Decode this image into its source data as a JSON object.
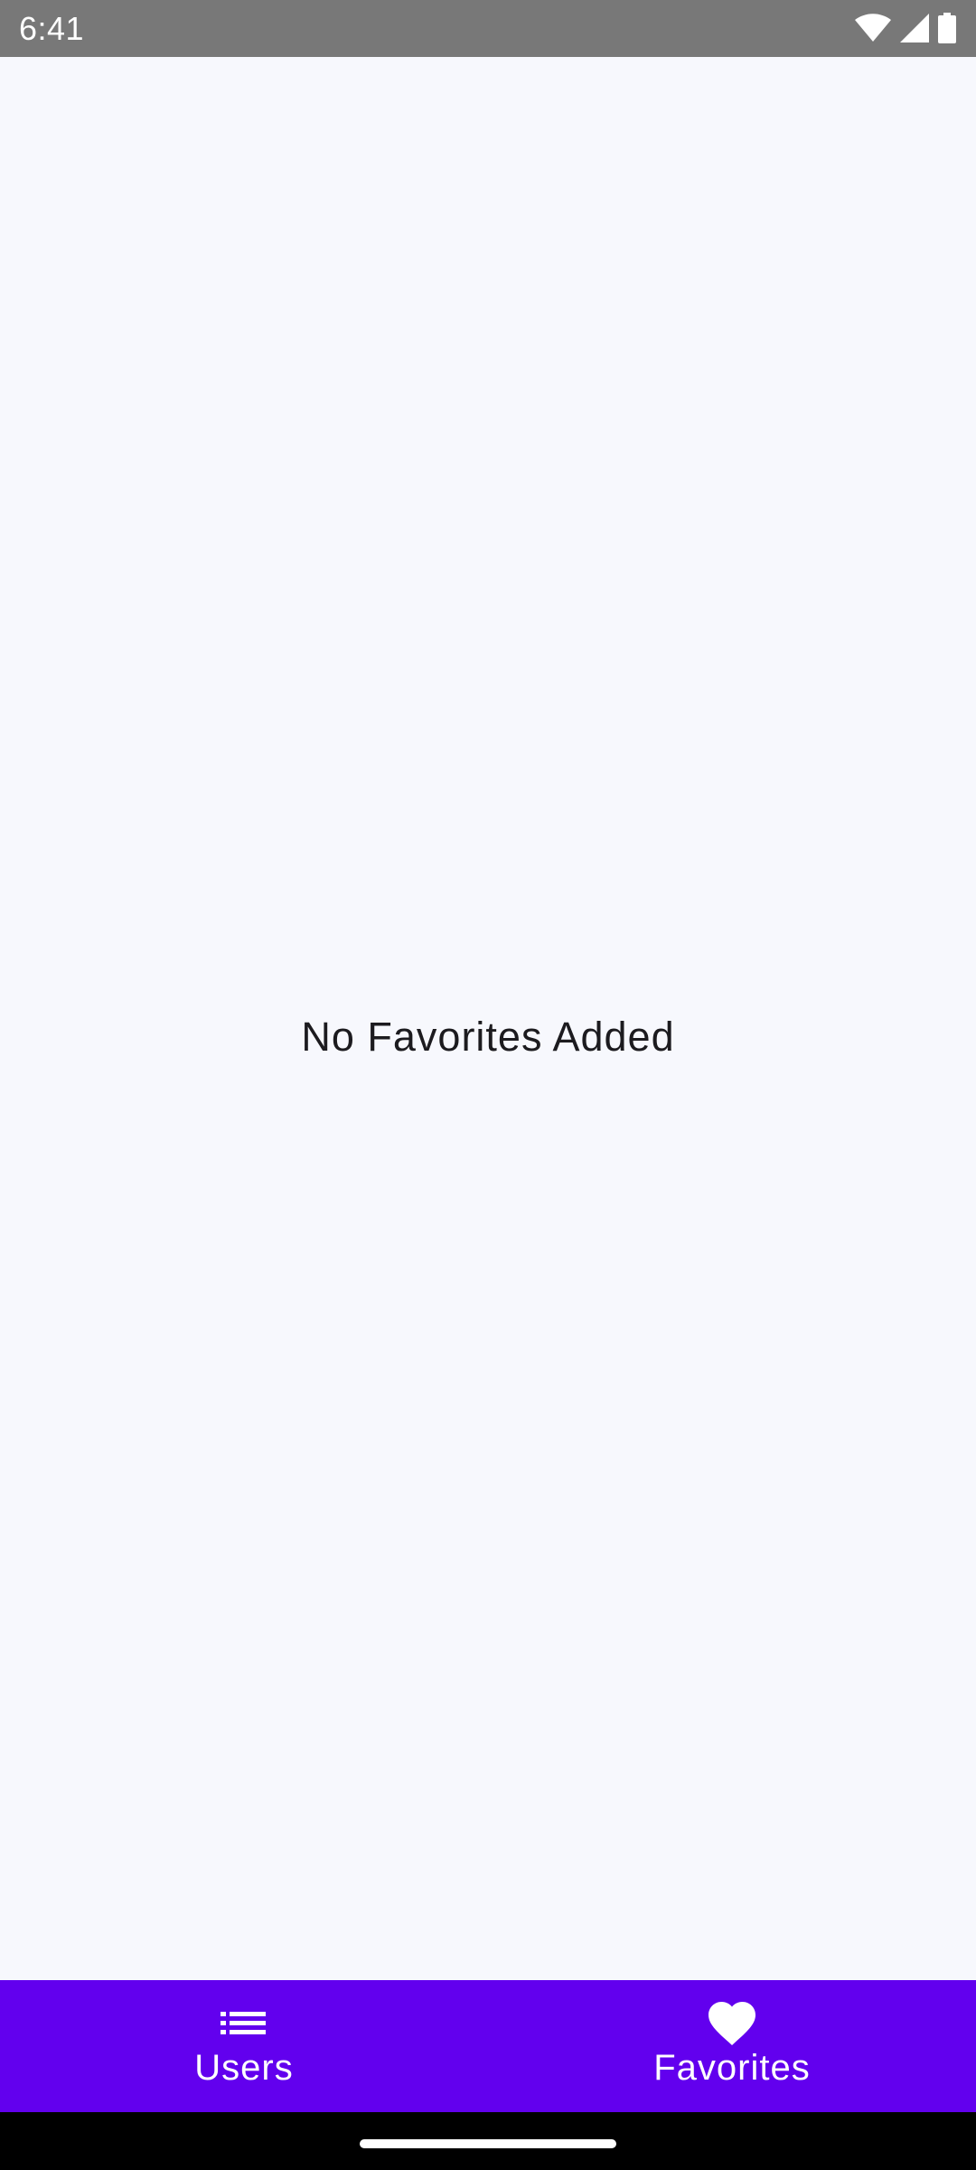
{
  "status_bar": {
    "time": "6:41",
    "icons": [
      "wifi-icon",
      "cellular-signal-icon",
      "battery-icon"
    ]
  },
  "main": {
    "empty_message": "No Favorites Added"
  },
  "bottom_nav": {
    "items": [
      {
        "label": "Users",
        "icon": "list-icon"
      },
      {
        "label": "Favorites",
        "icon": "heart-icon"
      }
    ]
  },
  "colors": {
    "status_bar": "#787878",
    "background": "#f7f8fd",
    "accent": "#6200ee",
    "text": "#1c1b1f",
    "nav_text": "#ffffff",
    "gesture_bar": "#000000"
  }
}
